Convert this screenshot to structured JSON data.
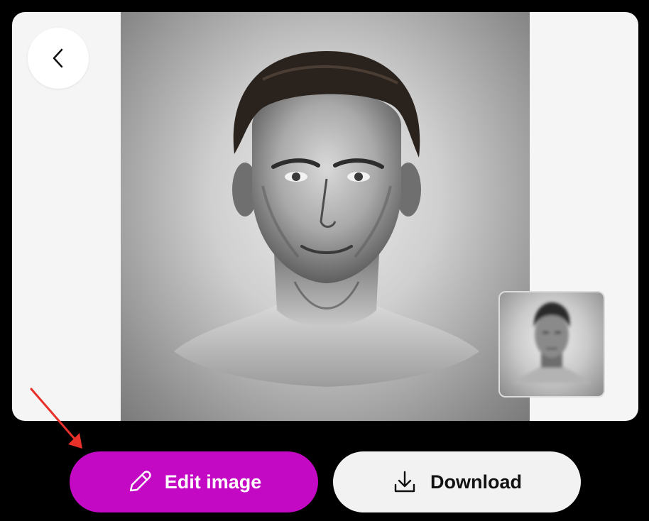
{
  "navigation": {
    "back_icon": "chevron-left-icon"
  },
  "preview": {
    "subject": "grayscale portrait illustration",
    "thumbnail_subject": "grayscale portrait illustration"
  },
  "actions": {
    "edit_label": "Edit image",
    "edit_icon": "pencil-icon",
    "download_label": "Download",
    "download_icon": "download-icon"
  },
  "colors": {
    "edit_button_bg": "#c309c3",
    "download_button_bg": "#f2f2f2",
    "card_bg": "#f5f5f5",
    "annotation_arrow": "#e8302a"
  }
}
